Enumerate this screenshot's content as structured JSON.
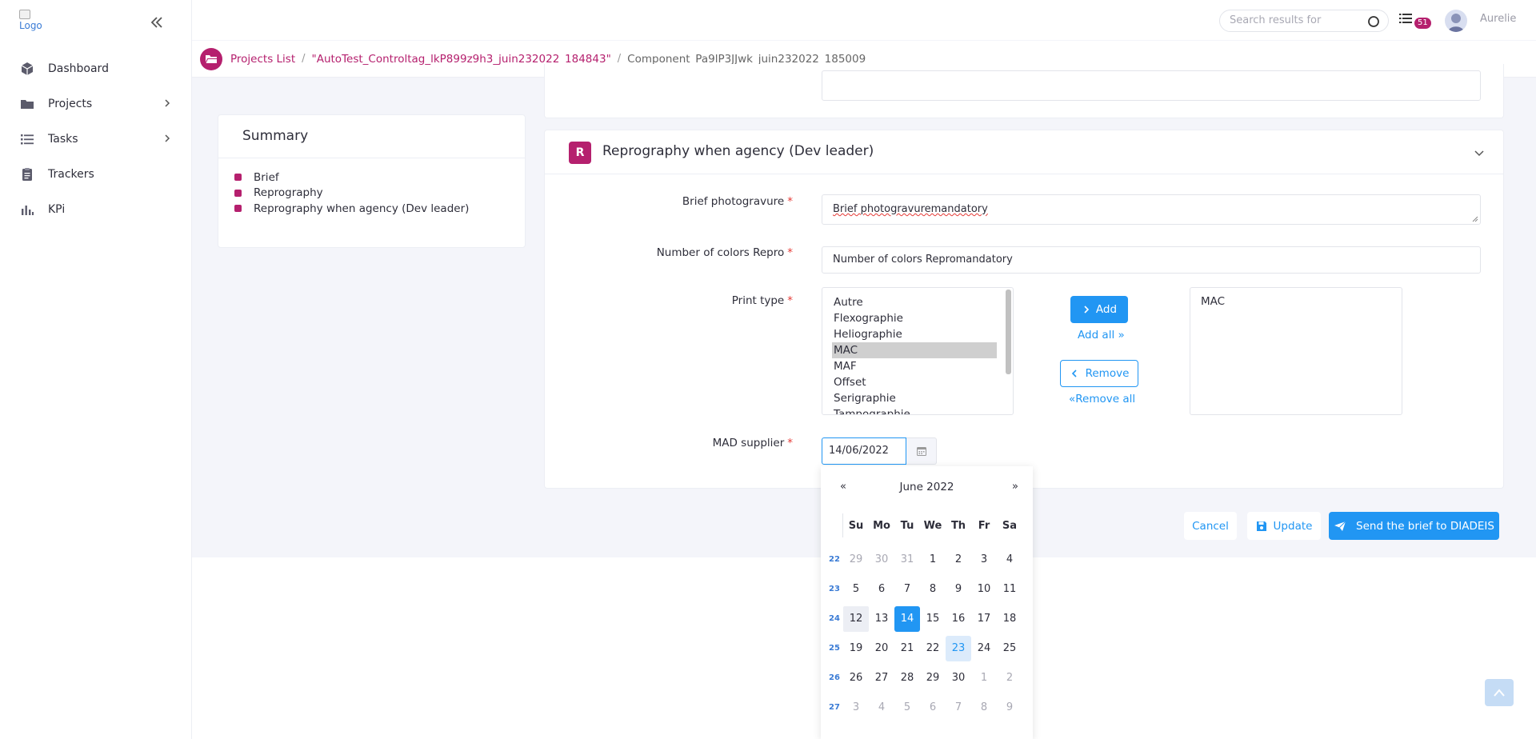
{
  "app": {
    "logo_alt": "Logo",
    "username": "Aurelie",
    "notification_count": "51"
  },
  "search": {
    "placeholder": "Search results for"
  },
  "sidebar": {
    "items": [
      {
        "label": "Dashboard",
        "icon": "cube-icon",
        "has_children": false
      },
      {
        "label": "Projects",
        "icon": "folder-icon",
        "has_children": true
      },
      {
        "label": "Tasks",
        "icon": "list-icon",
        "has_children": true
      },
      {
        "label": "Trackers",
        "icon": "clipboard-icon",
        "has_children": false
      },
      {
        "label": "KPi",
        "icon": "bar-chart-icon",
        "has_children": false
      }
    ]
  },
  "breadcrumb": {
    "items": [
      "Projects List",
      "\"AutoTest_Controltag_lkP899z9h3_juin232022_184843\"",
      "Component_Pa9lP3JJwk_juin232022_185009"
    ]
  },
  "summary": {
    "title": "Summary",
    "items": [
      "Brief",
      "Reprography",
      "Reprography when agency (Dev leader)"
    ]
  },
  "section": {
    "badge": "R",
    "title": "Reprography when agency (Dev leader)",
    "fields": {
      "brief_photogravure": {
        "label": "Brief photogravure",
        "value": "Brief photogravuremandatory"
      },
      "number_of_colors": {
        "label": "Number of colors Repro",
        "value": "Number of colors Repromandatory"
      },
      "print_type": {
        "label": "Print type",
        "options": [
          "Autre",
          "Flexographie",
          "Heliographie",
          "MAC",
          "MAF",
          "Offset",
          "Serigraphie",
          "Tampographie"
        ],
        "highlighted": "MAC",
        "selected": [
          "MAC"
        ],
        "add_label": "Add",
        "add_all_label": "Add all",
        "remove_label": "Remove",
        "remove_all_label": "Remove all"
      },
      "mad_supplier": {
        "label": "MAD supplier",
        "value": "14/06/2022"
      }
    }
  },
  "actions": {
    "cancel": "Cancel",
    "update": "Update",
    "send": "Send the brief to DIADEIS"
  },
  "datepicker": {
    "prev": "«",
    "next": "»",
    "title": "June 2022",
    "weekdays": [
      "Su",
      "Mo",
      "Tu",
      "We",
      "Th",
      "Fr",
      "Sa"
    ],
    "weeks": [
      {
        "num": "22",
        "days": [
          "29",
          "30",
          "31",
          "1",
          "2",
          "3",
          "4"
        ]
      },
      {
        "num": "23",
        "days": [
          "5",
          "6",
          "7",
          "8",
          "9",
          "10",
          "11"
        ]
      },
      {
        "num": "24",
        "days": [
          "12",
          "13",
          "14",
          "15",
          "16",
          "17",
          "18"
        ]
      },
      {
        "num": "25",
        "days": [
          "19",
          "20",
          "21",
          "22",
          "23",
          "24",
          "25"
        ]
      },
      {
        "num": "26",
        "days": [
          "26",
          "27",
          "28",
          "29",
          "30",
          "1",
          "2"
        ]
      },
      {
        "num": "27",
        "days": [
          "3",
          "4",
          "5",
          "6",
          "7",
          "8",
          "9"
        ]
      }
    ],
    "selected_day": "14",
    "today_day": "23"
  },
  "colors": {
    "accent": "#b5206e",
    "primary": "#2196f3"
  }
}
